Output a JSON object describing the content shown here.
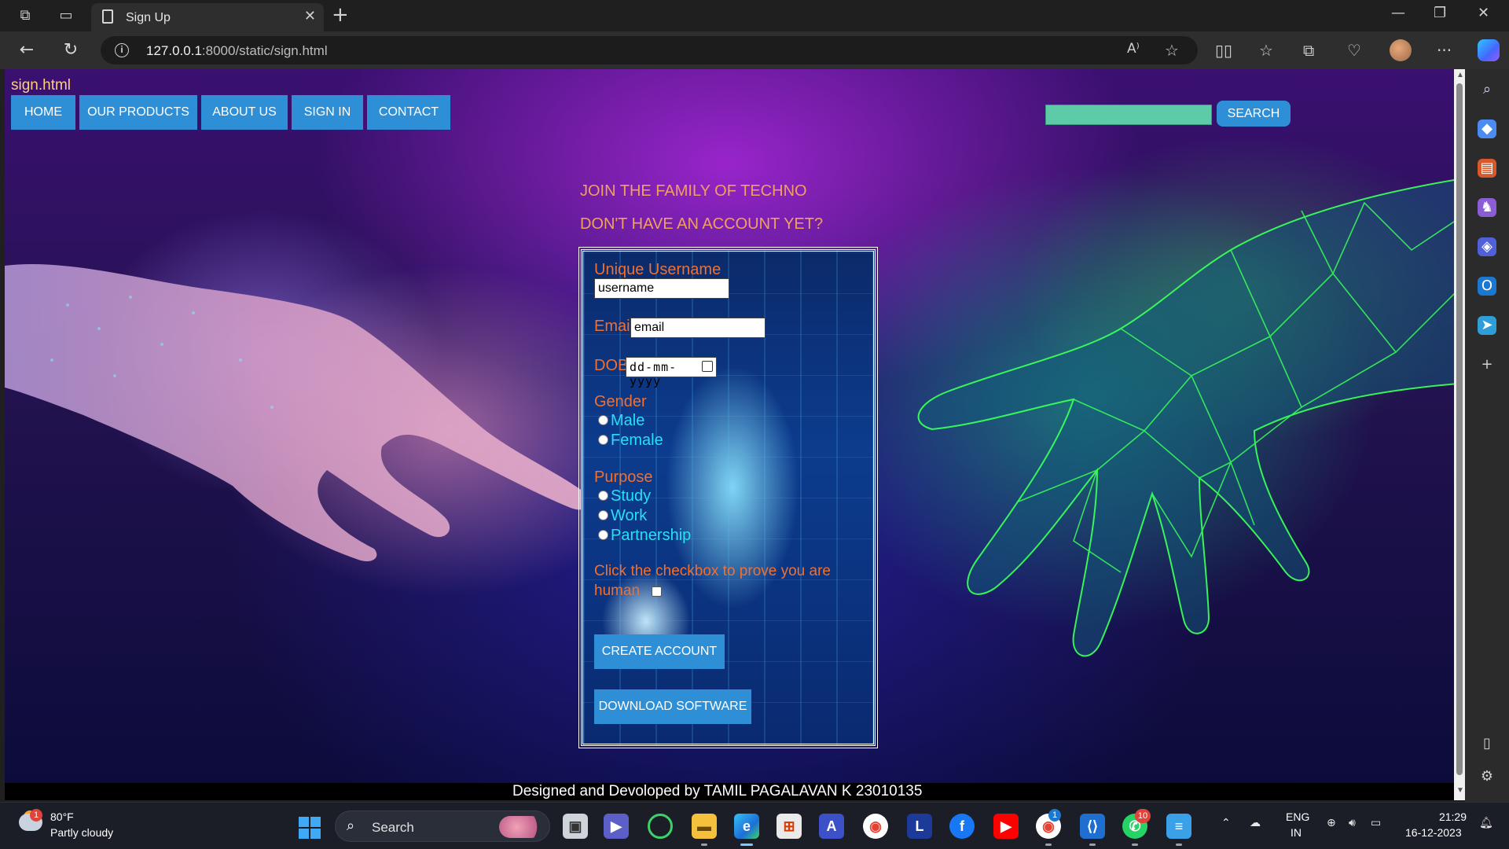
{
  "browser": {
    "tab_title": "Sign Up",
    "url_host": "127.0.0.1",
    "url_rest": ":8000/static/sign.html",
    "tab_close": "✕",
    "new_tab": "+"
  },
  "page": {
    "file_label": "sign.html",
    "nav": [
      "HOME",
      "OUR PRODUCTS",
      "ABOUT US",
      "SIGN IN",
      "CONTACT"
    ],
    "search_button": "SEARCH",
    "search_value": "",
    "heading1": "JOIN THE FAMILY OF TECHNO",
    "heading2": "DON'T HAVE AN ACCOUNT YET?",
    "form": {
      "username_label": "Unique Username",
      "username_placeholder": "username",
      "email_label": "Email",
      "email_placeholder": "email",
      "dob_label": "DOB",
      "dob_placeholder": "dd-mm-yyyy",
      "gender_label": "Gender",
      "gender_options": [
        "Male",
        "Female"
      ],
      "purpose_label": "Purpose",
      "purpose_options": [
        "Study",
        "Work",
        "Partnership"
      ],
      "captcha_line1": "Click the checkbox to prove you are",
      "captcha_line2": "human",
      "create_button": "CREATE ACCOUNT",
      "download_button": "DOWNLOAD SOFTWARE"
    },
    "footer": "Designed and Devoloped by TAMIL PAGALAVAN K 23010135"
  },
  "taskbar": {
    "weather_temp": "80°F",
    "weather_desc": "Partly cloudy",
    "weather_badge": "1",
    "search_label": "Search",
    "whatsapp_badge": "10",
    "chrome_badge": "1",
    "lang_line1": "ENG",
    "lang_line2": "IN",
    "time": "21:29",
    "date": "16-12-2023"
  },
  "colors": {
    "nav_button": "#2e8fd6",
    "form_label": "#f07030",
    "form_option": "#27e0f5",
    "heading": "#f0a060"
  }
}
